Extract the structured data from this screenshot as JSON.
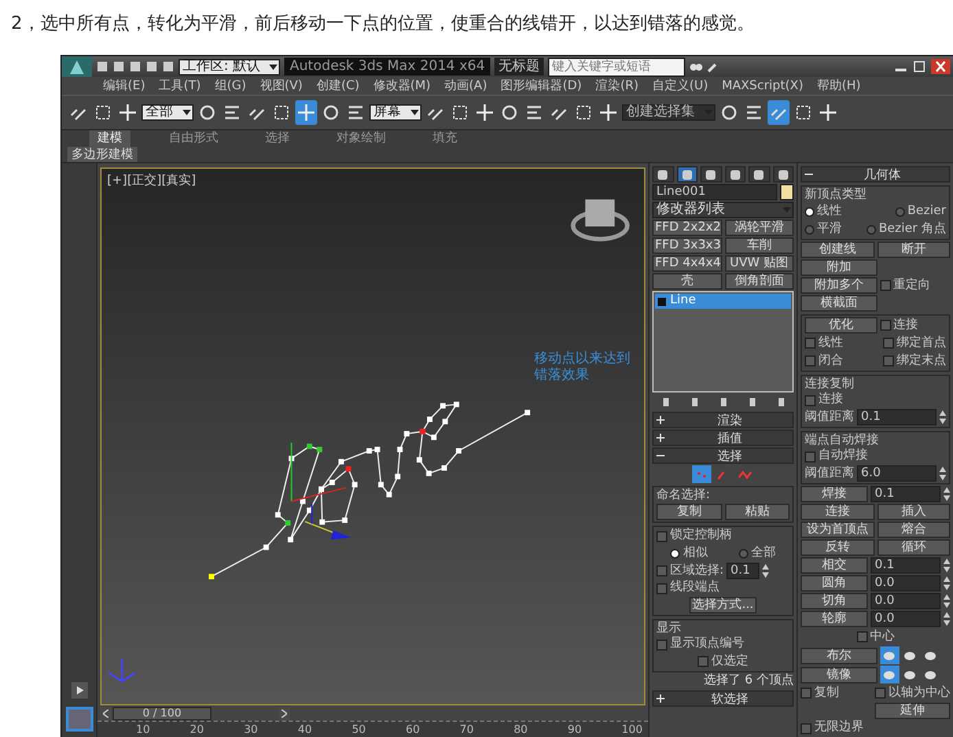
{
  "heading": "2，选中所有点，转化为平滑，前后移动一下点的位置，使重合的线错开，以达到错落的感觉。",
  "window": {
    "workspace": "工作区: 默认",
    "title": "Autodesk 3ds Max  2014 x64",
    "document": "无标题",
    "search": {
      "placeholder": "键入关键字或短语"
    }
  },
  "menu": [
    "编辑(E)",
    "工具(T)",
    "组(G)",
    "视图(V)",
    "创建(C)",
    "修改器(M)",
    "动画(A)",
    "图形编辑器(D)",
    "渲染(R)",
    "自定义(U)",
    "MAXScript(X)",
    "帮助(H)"
  ],
  "toolbar": {
    "selection_filter": "全部",
    "coordinate_system": "屏幕",
    "named_selection_set": "创建选择集",
    "tools": [
      {
        "selected": false
      },
      {
        "selected": false
      },
      {
        "selected": false
      },
      {
        "selected": false
      },
      {
        "selected": false
      },
      {
        "selected": false
      },
      {
        "selected": false
      },
      {
        "selected": true
      },
      {
        "selected": false
      },
      {
        "selected": false
      },
      {
        "selected": false
      },
      {
        "selected": false
      },
      {
        "selected": false
      },
      {
        "selected": false
      },
      {
        "selected": false
      },
      {
        "selected": false
      },
      {
        "selected": false
      },
      {
        "selected": false
      },
      {
        "selected": false
      },
      {
        "selected": false
      },
      {
        "selected": true
      },
      {
        "selected": false
      },
      {
        "selected": false
      }
    ]
  },
  "ribbon": {
    "tabs": [
      {
        "label": "建模",
        "selected": true
      },
      {
        "label": "自由形式",
        "selected": false
      },
      {
        "label": "选择",
        "selected": false
      },
      {
        "label": "对象绘制",
        "selected": false
      },
      {
        "label": "填充",
        "selected": false
      }
    ],
    "panel_tab": "多边形建模"
  },
  "viewport": {
    "label": "[+][正交][真实]",
    "annotation": [
      "移动点以来达到",
      "错落效果"
    ]
  },
  "timeline": {
    "position": "0 / 100",
    "level": 0,
    "ticks": [
      "10",
      "20",
      "30",
      "40",
      "50",
      "60",
      "70",
      "80",
      "90",
      "100"
    ]
  },
  "command_panel": {
    "tabs": [
      {
        "selected": false
      },
      {
        "selected": true
      },
      {
        "selected": false
      },
      {
        "selected": false
      },
      {
        "selected": false
      },
      {
        "selected": false
      }
    ],
    "object_name": "Line001",
    "modifier_list": "修改器列表",
    "modifier_buttons": [
      "FFD 2x2x2",
      "涡轮平滑",
      "FFD 3x3x3",
      "车削",
      "FFD 4x4x4",
      "UVW 贴图",
      "壳",
      "倒角剖面"
    ],
    "stack": [
      {
        "label": "Line",
        "selected": true
      }
    ],
    "rollouts": [
      {
        "title": "渲染",
        "expanded": false
      },
      {
        "title": "插值",
        "expanded": false
      },
      {
        "title": "选择",
        "expanded": true
      }
    ],
    "selection": {
      "levels": [
        {
          "selected": true
        },
        {
          "selected": false
        },
        {
          "selected": false
        }
      ],
      "named_title": "命名选择:",
      "copy": "复制",
      "paste": "粘贴",
      "lock_handles": {
        "label": "锁定控制柄",
        "checked": false
      },
      "handle_modes": [
        {
          "label": "相似",
          "selected": true
        },
        {
          "label": "全部",
          "selected": false
        }
      ],
      "area_selection": {
        "label": "区域选择:",
        "checked": false,
        "value": "0.1"
      },
      "segment_end": {
        "label": "线段端点",
        "checked": false
      },
      "select_by": "选择方式...",
      "display_title": "显示",
      "show_numbers": {
        "label": "显示顶点编号",
        "checked": false
      },
      "selected_only": {
        "label": "仅选定",
        "checked": false
      },
      "status": "选择了 6 个顶点"
    },
    "soft_selection": {
      "title": "软选择",
      "expanded": false
    }
  },
  "geometry": {
    "title": "几何体",
    "expanded": true,
    "vertex_type": {
      "title": "新顶点类型",
      "options": [
        {
          "label": "线性",
          "selected": true
        },
        {
          "label": "Bezier",
          "selected": false
        },
        {
          "label": "平滑",
          "selected": false
        },
        {
          "label": "Bezier 角点",
          "selected": false
        }
      ]
    },
    "create_line": "创建线",
    "break": "断开",
    "attach": "附加",
    "attach_multiple": "附加多个",
    "reorient": {
      "label": "重定向",
      "checked": false
    },
    "cross_section": "横截面",
    "refine": "优化",
    "refine_options": [
      {
        "label": "连接",
        "checked": false
      },
      {
        "label": "线性",
        "checked": false
      },
      {
        "label": "绑定首点",
        "checked": false
      },
      {
        "label": "闭合",
        "checked": false
      },
      {
        "label": "绑定末点",
        "checked": false
      }
    ],
    "connect_copy": {
      "title": "连接复制",
      "connect": {
        "label": "连接",
        "checked": false
      },
      "threshold_label": "阈值距离",
      "threshold": "0.1"
    },
    "auto_weld": {
      "title": "端点自动焊接",
      "weld": {
        "label": "自动焊接",
        "checked": false
      },
      "threshold_label": "阈值距离",
      "threshold": "6.0"
    },
    "ops": [
      {
        "kind": "spinner",
        "label": "焊接",
        "value": "0.1"
      },
      {
        "kind": "pair",
        "labels": [
          "连接",
          "插入"
        ]
      },
      {
        "kind": "pair",
        "labels": [
          "设为首顶点",
          "熔合"
        ]
      },
      {
        "kind": "pair",
        "labels": [
          "反转",
          "循环"
        ]
      },
      {
        "kind": "spinner",
        "label": "相交",
        "value": "0.1"
      },
      {
        "kind": "spinner",
        "label": "圆角",
        "value": "0.0"
      },
      {
        "kind": "spinner",
        "label": "切角",
        "value": "0.0"
      },
      {
        "kind": "spinner",
        "label": "轮廓",
        "value": "0.0"
      }
    ],
    "center": {
      "label": "中心",
      "checked": false
    },
    "boolean": {
      "label": "布尔",
      "ops": [
        {
          "selected": true
        },
        {
          "selected": false
        },
        {
          "selected": false
        }
      ]
    },
    "mirror": {
      "label": "镜像",
      "ops": [
        {
          "selected": true
        },
        {
          "selected": false
        },
        {
          "selected": false
        }
      ]
    },
    "copy": {
      "label": "复制",
      "checked": false
    },
    "about_pivot": {
      "label": "以轴为中心",
      "checked": false
    },
    "extend": "延伸",
    "infinite_bounds": {
      "label": "无限边界",
      "checked": false
    }
  }
}
